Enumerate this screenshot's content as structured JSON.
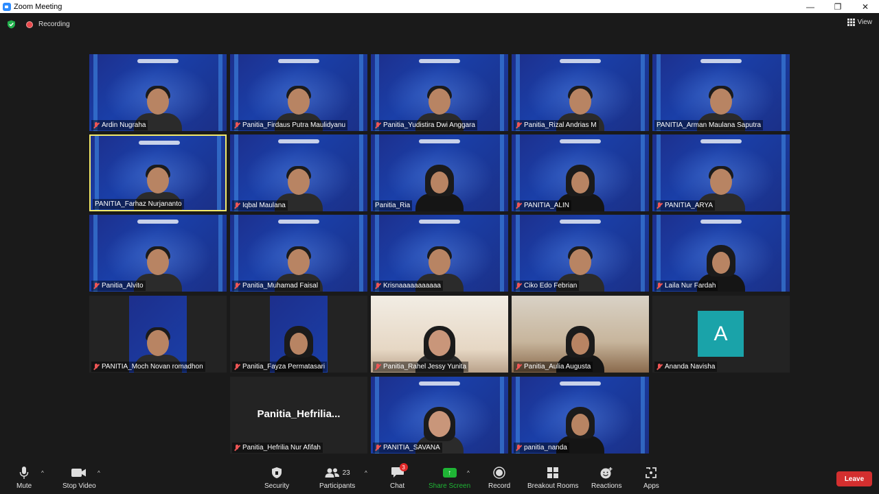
{
  "window": {
    "title": "Zoom Meeting"
  },
  "status": {
    "recording_label": "Recording",
    "view_label": "View"
  },
  "tiles": [
    {
      "name": "Ardin Nugraha",
      "muted": true,
      "bg": "itdev",
      "person": "male"
    },
    {
      "name": "Panitia_Firdaus Putra Maulidyanu",
      "muted": true,
      "bg": "itdev",
      "person": "male"
    },
    {
      "name": "Panitia_Yudistira Dwi Anggara",
      "muted": true,
      "bg": "itdev",
      "person": "male"
    },
    {
      "name": "Panitia_Rizal Andrias M",
      "muted": true,
      "bg": "itdev",
      "person": "male"
    },
    {
      "name": "PANITIA_Arman Maulana Saputra",
      "muted": false,
      "bg": "itdev",
      "person": "male"
    },
    {
      "name": "PANITIA_Farhaz Nurjananto",
      "muted": false,
      "bg": "itdev",
      "person": "male",
      "speaker": true
    },
    {
      "name": "Iqbal Maulana",
      "muted": true,
      "bg": "itdev",
      "person": "male"
    },
    {
      "name": "Panitia_Ria",
      "muted": false,
      "bg": "itdev",
      "person": "hijab"
    },
    {
      "name": "PANITIA_ALIN",
      "muted": true,
      "bg": "itdev",
      "person": "hijab"
    },
    {
      "name": "PANITIA_ARYA",
      "muted": true,
      "bg": "itdev",
      "person": "male"
    },
    {
      "name": "Panitia_Alvito",
      "muted": true,
      "bg": "itdev",
      "person": "male"
    },
    {
      "name": "Panitia_Muhamad Faisal",
      "muted": true,
      "bg": "itdev",
      "person": "male"
    },
    {
      "name": "Krisnaaaaaaaaaaa",
      "muted": true,
      "bg": "itdev",
      "person": "male"
    },
    {
      "name": "Ciko Edo Febrian",
      "muted": true,
      "bg": "itdev",
      "person": "male"
    },
    {
      "name": "Laila Nur Fardah",
      "muted": true,
      "bg": "itdev",
      "person": "hijab"
    },
    {
      "name": "PANITIA_Moch Novan romadhon",
      "muted": true,
      "bg": "dark-itdev",
      "person": "male"
    },
    {
      "name": "Panitia_Fayza Permatasari",
      "muted": true,
      "bg": "dark-itdev",
      "person": "hijab"
    },
    {
      "name": "Panitia_Rahel Jessy Yunita",
      "muted": true,
      "bg": "light",
      "person": "female"
    },
    {
      "name": "Panitia_Aulia Augusta",
      "muted": true,
      "bg": "room",
      "person": "hijab"
    },
    {
      "name": "Ananda Navisha",
      "muted": true,
      "bg": "avatar",
      "avatar_letter": "A"
    },
    {
      "name": "Panitia_Hefrilia Nur Afifah",
      "muted": true,
      "bg": "nameonly",
      "display_name": "Panitia_Hefrilia..."
    },
    {
      "name": "PANITIA_SAVANA",
      "muted": true,
      "bg": "itdev",
      "person": "female"
    },
    {
      "name": "panitia_nanda",
      "muted": true,
      "bg": "itdev",
      "person": "hijab"
    }
  ],
  "toolbar": {
    "mute": "Mute",
    "stop_video": "Stop Video",
    "security": "Security",
    "participants": "Participants",
    "participants_count": "23",
    "chat": "Chat",
    "chat_badge": "3",
    "share_screen": "Share Screen",
    "record": "Record",
    "breakout_rooms": "Breakout Rooms",
    "reactions": "Reactions",
    "apps": "Apps",
    "leave": "Leave"
  },
  "colors": {
    "share_green": "#1fb535",
    "leave_red": "#d32f2f",
    "speaker_border": "#f3ea6a",
    "avatar_teal": "#1aa3a9"
  }
}
